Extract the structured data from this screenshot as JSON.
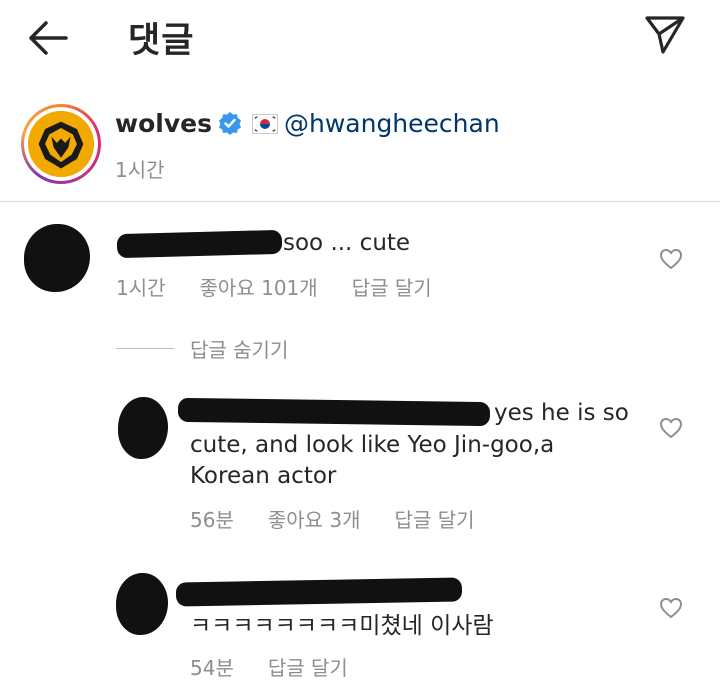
{
  "header": {
    "title": "댓글"
  },
  "post": {
    "username": "wolves",
    "mention": "@hwangheechan",
    "time": "1시간"
  },
  "comments": [
    {
      "text": "soo ... cute",
      "time": "1시간",
      "likes": "좋아요 101개",
      "reply": "답글 달기"
    }
  ],
  "hide_replies": "답글 숨기기",
  "replies": [
    {
      "text": "yes he is so cute, and look like Yeo Jin-goo,a Korean actor",
      "line1": "yes he is so",
      "line2": "cute, and look like Yeo Jin-goo,a",
      "line3": "Korean actor",
      "time": "56분",
      "likes": "좋아요 3개",
      "reply": "답글 달기"
    },
    {
      "text": "ㅋㅋㅋㅋㅋㅋㅋㅋ미쳤네 이사람",
      "time": "54분",
      "reply": "답글 달기"
    }
  ],
  "colors": {
    "text": "#262626",
    "secondary": "#8e8e8e",
    "mention": "#00376b",
    "verified": "#3897f0",
    "divider": "#dbdbdb"
  },
  "icons": [
    "back-arrow-icon",
    "send-icon",
    "verified-badge-icon",
    "korea-flag-icon",
    "heart-icon"
  ]
}
